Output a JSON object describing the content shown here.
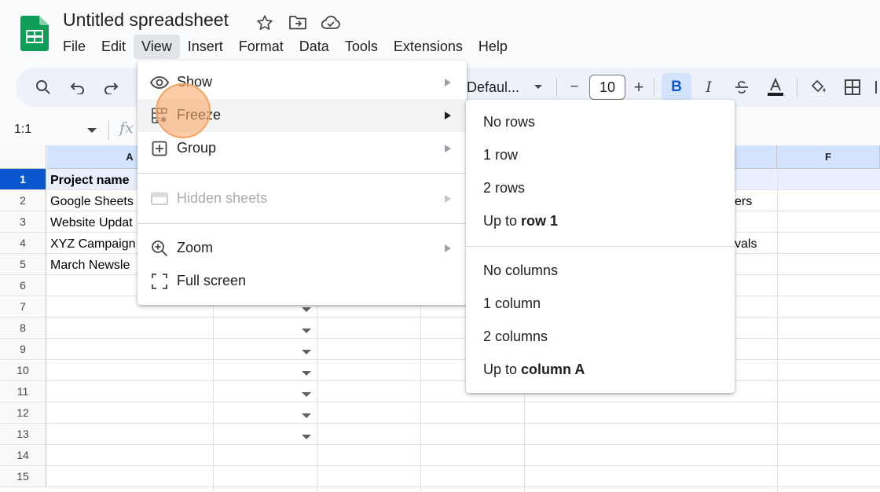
{
  "app": {
    "title": "Untitled spreadsheet",
    "accent": "#0b57d0",
    "logo_color": "#0f9d58"
  },
  "menubar": [
    "File",
    "Edit",
    "View",
    "Insert",
    "Format",
    "Data",
    "Tools",
    "Extensions",
    "Help"
  ],
  "menubar_active": "View",
  "toolbar": {
    "font_name": "Defaul...",
    "font_size": "10",
    "bold_label": "B",
    "italic_label": "I",
    "minus_label": "−",
    "plus_label": "+"
  },
  "namebox": {
    "value": "1:1"
  },
  "formula_bar": {
    "fx_label": "fx"
  },
  "grid": {
    "column_headers": [
      "A",
      "F"
    ],
    "row_numbers": [
      "1",
      "2",
      "3",
      "4",
      "5",
      "6",
      "7",
      "8",
      "9",
      "10",
      "11",
      "12",
      "13",
      "14",
      "15"
    ],
    "selected_row": "1",
    "cells": {
      "A1": "Project name",
      "A2": "Google Sheets",
      "A3": "Website Updat",
      "A4": "XYZ Campaign",
      "A5": "March Newsle",
      "E2": "ers",
      "E4": "vals"
    }
  },
  "view_menu": {
    "items": [
      {
        "label": "Show",
        "icon": "eye-icon"
      },
      {
        "label": "Freeze",
        "icon": "freeze-icon"
      },
      {
        "label": "Group",
        "icon": "group-icon"
      },
      {
        "label": "Hidden sheets",
        "icon": "hidden-sheets-icon",
        "disabled": true
      },
      {
        "label": "Zoom",
        "icon": "zoom-icon"
      },
      {
        "label": "Full screen",
        "icon": "fullscreen-icon"
      }
    ]
  },
  "freeze_submenu": {
    "no_rows": "No rows",
    "one_row": "1 row",
    "two_rows": "2 rows",
    "up_to_row_prefix": "Up to",
    "up_to_row_value": "row 1",
    "no_columns": "No columns",
    "one_column": "1 column",
    "two_columns": "2 columns",
    "up_to_column_prefix": "Up to",
    "up_to_column_value": "column A"
  }
}
